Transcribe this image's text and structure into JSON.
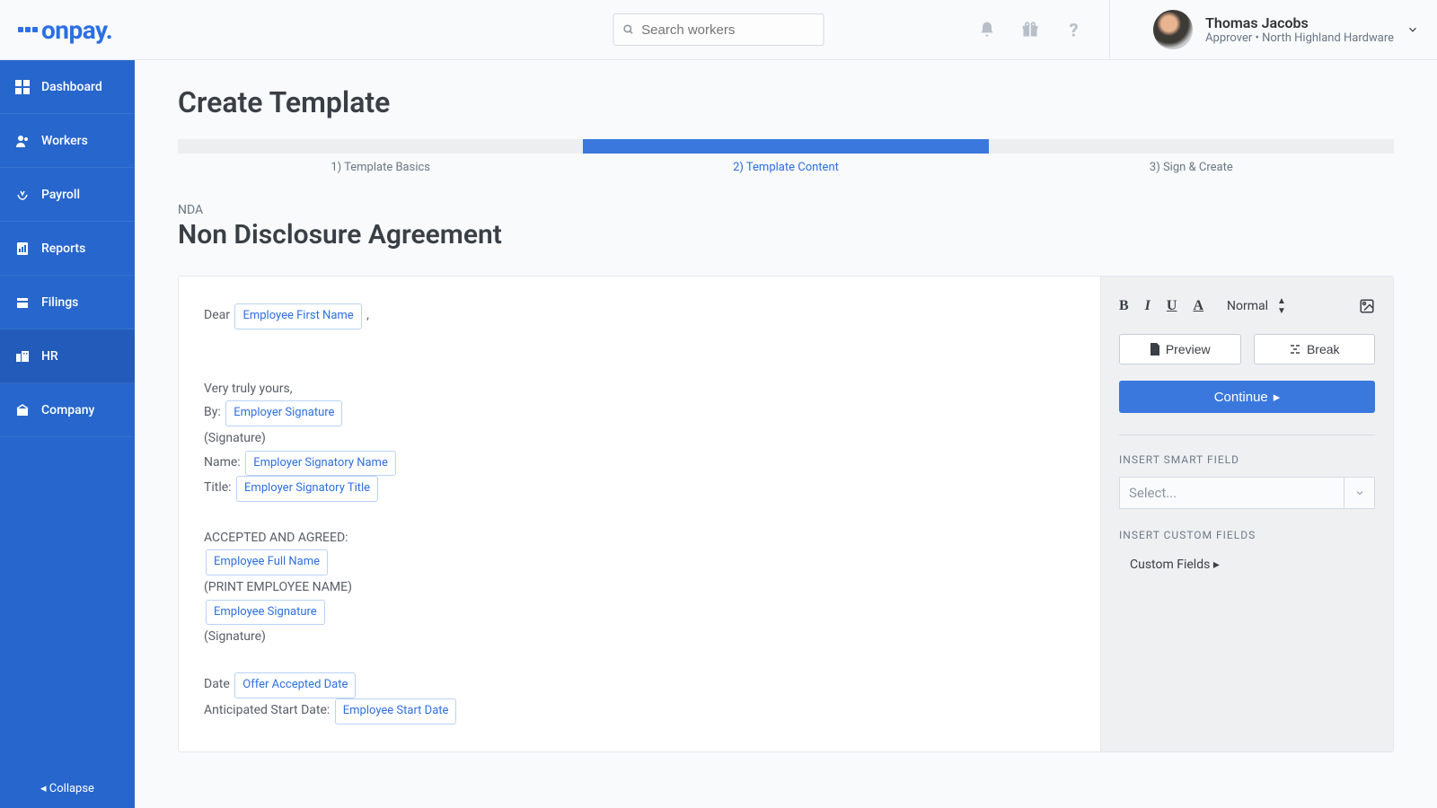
{
  "header": {
    "search_placeholder": "Search workers",
    "user_name": "Thomas Jacobs",
    "user_subtitle": "Approver • North Highland Hardware"
  },
  "sidebar": {
    "items": [
      {
        "label": "Dashboard"
      },
      {
        "label": "Workers"
      },
      {
        "label": "Payroll"
      },
      {
        "label": "Reports"
      },
      {
        "label": "Filings"
      },
      {
        "label": "HR"
      },
      {
        "label": "Company"
      }
    ],
    "collapse": "Collapse"
  },
  "page": {
    "title": "Create Template",
    "steps": [
      {
        "label": "1) Template Basics"
      },
      {
        "label": "2) Template Content"
      },
      {
        "label": "3) Sign & Create"
      }
    ],
    "doc_tag": "NDA",
    "doc_title": "Non Disclosure Agreement"
  },
  "editor": {
    "dear": "Dear",
    "token_first_name": "Employee First Name",
    "truly_yours": "Very truly yours,",
    "by": "By:",
    "token_emp_sig": "Employer Signature",
    "signature": "(Signature)",
    "name": "Name:",
    "token_emp_sig_name": "Employer Signatory Name",
    "title": "Title:",
    "token_emp_sig_title": "Employer Signatory Title",
    "accepted": "ACCEPTED AND AGREED:",
    "token_emp_full": "Employee Full Name",
    "print_name": "(PRINT EMPLOYEE NAME)",
    "token_employee_sig": "Employee Signature",
    "signature2": "(Signature)",
    "date": "Date",
    "token_offer_date": "Offer Accepted Date",
    "anticipated": "Anticipated Start Date:",
    "token_start_date": "Employee Start Date"
  },
  "panel": {
    "font_size": "Normal",
    "preview": "Preview",
    "break": "Break",
    "continue": "Continue",
    "smart_label": "INSERT SMART FIELD",
    "select_placeholder": "Select...",
    "custom_label": "INSERT CUSTOM FIELDS",
    "custom_fields": "Custom Fields"
  }
}
